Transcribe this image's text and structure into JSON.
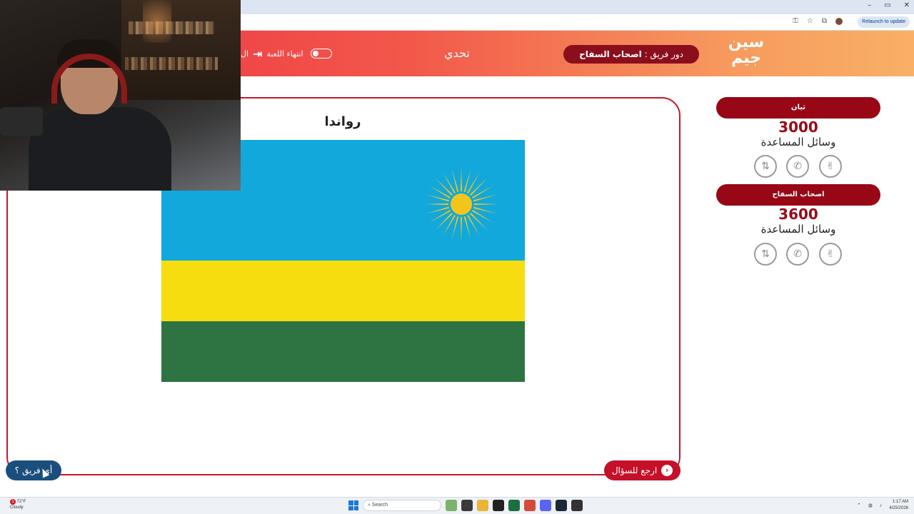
{
  "browser": {
    "relaunch_label": "Relaunch to update",
    "window_controls": [
      "–",
      "▭",
      "✕"
    ],
    "icons": [
      "key-icon",
      "star-icon",
      "extensions-icon",
      "profile-avatar"
    ]
  },
  "header": {
    "logo_text": "سين جيم",
    "team_turn_prefix": "دور فريق :",
    "team_turn_name": "اصحاب السفاح",
    "challenge_label": "تحدي",
    "end_game_label": "انتهاء اللعبة",
    "cut_text": "ال"
  },
  "question": {
    "country_name": "رواندا",
    "flag_colors": {
      "blue": "#12a8dc",
      "yellow": "#f6dd0f",
      "green": "#2e7443",
      "sun": "#f3c51a"
    }
  },
  "buttons": {
    "back_to_question": "ارجع للسؤال",
    "back_icon": "‹",
    "which_team": "أي فريق ؟"
  },
  "teams": [
    {
      "name": "ثيان",
      "score": "3000",
      "aids_label": "وسائل المساعدة",
      "aids": [
        "swap-icon",
        "phone-icon",
        "peace-hand-icon"
      ]
    },
    {
      "name": "اصحاب السفاح",
      "score": "3600",
      "aids_label": "وسائل المساعدة",
      "aids": [
        "swap-icon",
        "phone-icon",
        "peace-hand-icon"
      ]
    }
  ],
  "taskbar": {
    "weather_temp": "72°F",
    "weather_desc": "Cloudy",
    "notification_count": "1",
    "search_placeholder": "Search",
    "time": "1:17 AM",
    "date": "4/25/2026"
  },
  "colors": {
    "accent_red": "#c5102a",
    "team_pill": "#970715",
    "score": "#980a18",
    "which_btn": "#1a4f7d"
  }
}
